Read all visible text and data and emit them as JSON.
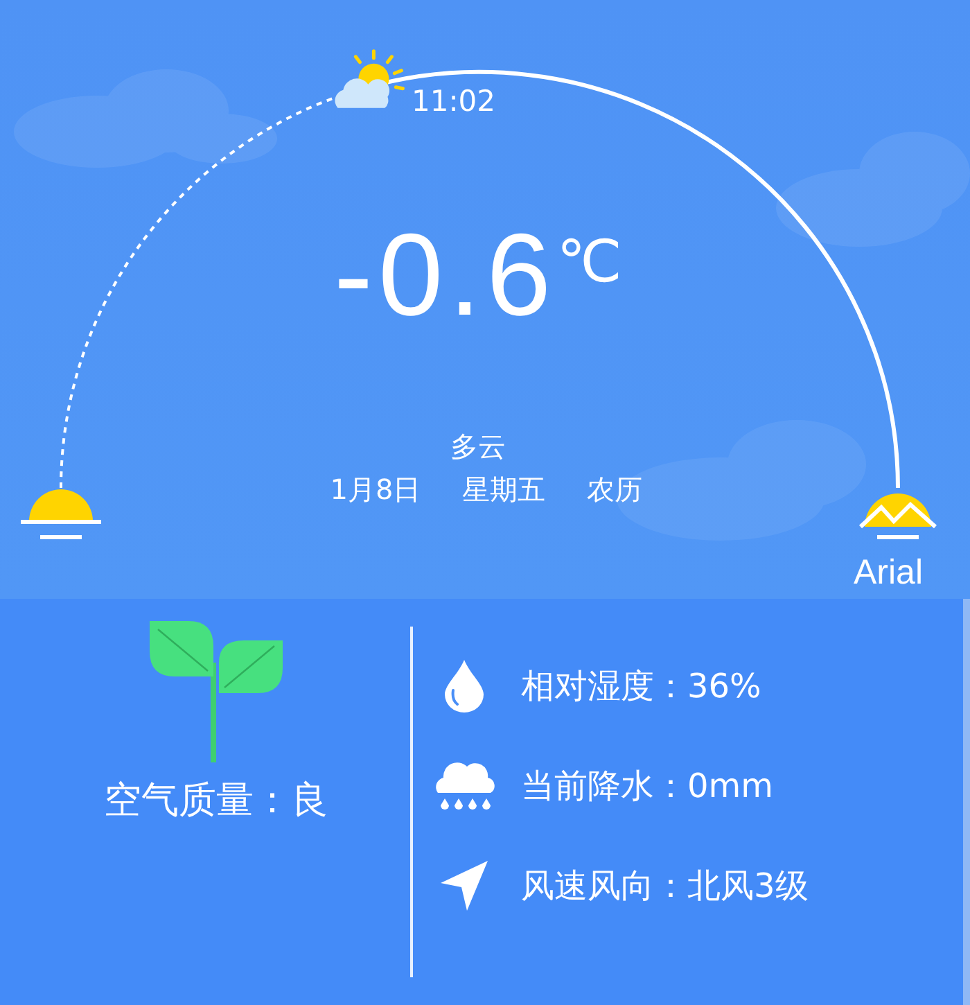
{
  "sky": {
    "time": "11:02",
    "temperature": "-0.6",
    "unit": "℃",
    "condition": "多云",
    "date": "1月8日",
    "weekday": "星期五",
    "lunar": "农历",
    "sunset_label": "Arial"
  },
  "air_quality": {
    "label": "空气质量：良"
  },
  "details": [
    {
      "kind": "humidity",
      "label": "相对湿度：36%"
    },
    {
      "kind": "precipitation",
      "label": "当前降水：0mm"
    },
    {
      "kind": "wind",
      "label": "风速风向：北风3级"
    }
  ]
}
